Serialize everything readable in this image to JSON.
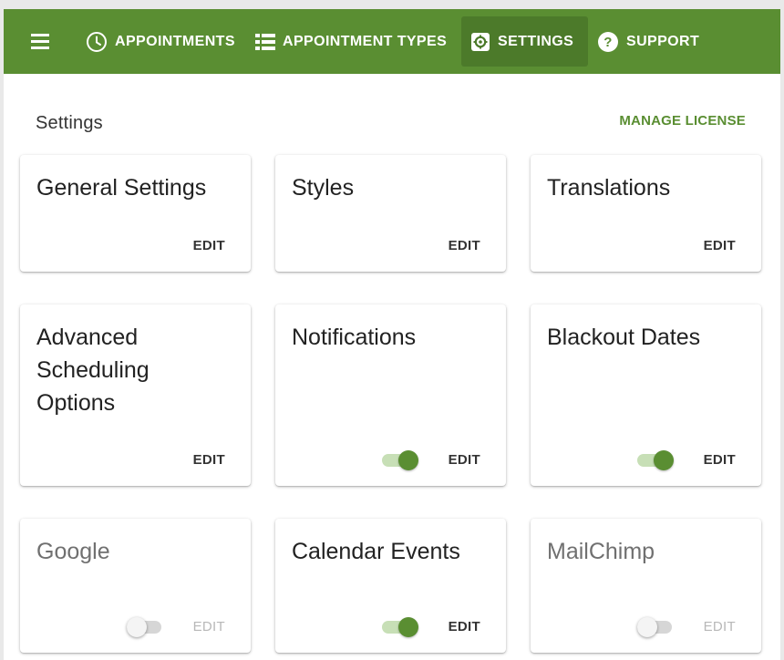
{
  "nav": {
    "menu_icon": "hamburger-menu-icon",
    "items": [
      {
        "label": "APPOINTMENTS",
        "icon": "clock-icon"
      },
      {
        "label": "APPOINTMENT TYPES",
        "icon": "list-icon"
      },
      {
        "label": "SETTINGS",
        "icon": "gear-icon",
        "active": true
      },
      {
        "label": "SUPPORT",
        "icon": "help-circle-icon"
      }
    ]
  },
  "page": {
    "title": "Settings",
    "manage_license": "MANAGE LICENSE"
  },
  "colors": {
    "brand": "#5a8e32",
    "active_nav": "#4c7a2a",
    "toggle_track_on": "#c7dfb6"
  },
  "cards": [
    {
      "title": "General Settings",
      "edit": "EDIT"
    },
    {
      "title": "Styles",
      "edit": "EDIT"
    },
    {
      "title": "Translations",
      "edit": "EDIT"
    },
    {
      "title": "Advanced Scheduling Options",
      "edit": "EDIT"
    },
    {
      "title": "Notifications",
      "edit": "EDIT",
      "toggle": "on"
    },
    {
      "title": "Blackout Dates",
      "edit": "EDIT",
      "toggle": "on"
    },
    {
      "title": "Google",
      "edit": "EDIT",
      "toggle": "off",
      "disabled": true
    },
    {
      "title": "Calendar Events",
      "edit": "EDIT",
      "toggle": "on"
    },
    {
      "title": "MailChimp",
      "edit": "EDIT",
      "toggle": "off",
      "disabled": true
    }
  ]
}
